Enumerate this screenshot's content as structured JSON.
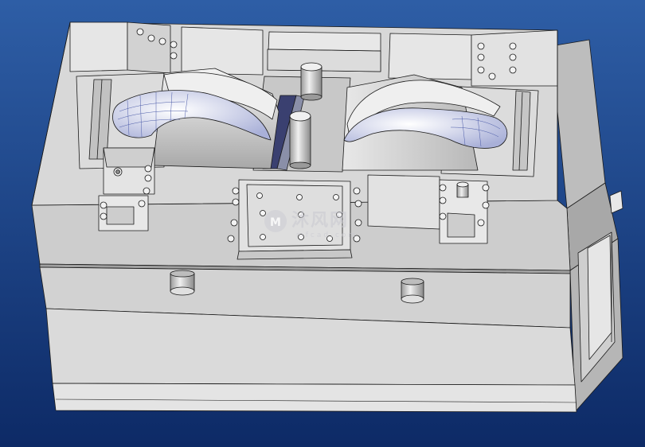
{
  "viewport": {
    "background_top": "#2e5ea6",
    "background_bottom": "#0d2a66",
    "model_fill": "#e2e2e2",
    "model_shadow": "#b4b4b4",
    "model_dark": "#8c8c8c",
    "edge_color": "#1a1a1a",
    "highlight_face": "#4a5080"
  },
  "watermark": {
    "text": "沐风网",
    "sub": "mfcad.com",
    "logo_icon": "mf-logo-icon"
  }
}
